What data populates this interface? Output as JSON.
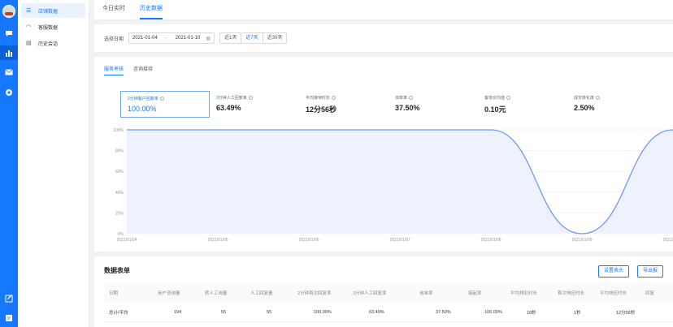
{
  "rail": {
    "items": [
      "avatar",
      "chat-icon",
      "chart-icon",
      "mail-icon",
      "settings-icon",
      "edit-icon",
      "note-icon"
    ]
  },
  "subnav": {
    "items": [
      {
        "label": "店铺数据",
        "icon": "list-icon"
      },
      {
        "label": "客服数据",
        "icon": "headset-icon"
      },
      {
        "label": "历史会话",
        "icon": "document-icon"
      }
    ],
    "active_index": 0
  },
  "top_tabs": [
    "今日实时",
    "历史数据"
  ],
  "active_top_tab": 1,
  "filter": {
    "label": "选择日期",
    "start": "2021-01-04",
    "separator": "-",
    "end": "2021-01-10",
    "quick": [
      "近1天",
      "近7天",
      "近30天"
    ],
    "active_quick": 1
  },
  "sub_tabs": [
    "服务考核",
    "咨询接待"
  ],
  "active_sub_tab": 0,
  "kpis": [
    {
      "label": "2分钟客户回复率",
      "value": "100.00%"
    },
    {
      "label": "3分钟人工回复率",
      "value": "63.49%"
    },
    {
      "label": "平均接待时长",
      "value": "12分56秒"
    },
    {
      "label": "询单率",
      "value": "37.50%"
    },
    {
      "label": "客单价均值",
      "value": "0.10元"
    },
    {
      "label": "成交转化率",
      "value": "2.50%"
    }
  ],
  "active_kpi": 0,
  "chart_data": {
    "type": "area",
    "x": [
      "2021/01/04",
      "2021/01/05",
      "2021/01/06",
      "2021/01/07",
      "2021/01/08",
      "2021/01/09",
      "2021/01/10"
    ],
    "series": [
      {
        "values": [
          100,
          100,
          100,
          100,
          100,
          0,
          100
        ]
      }
    ],
    "ytick_labels": [
      "0%",
      "20%",
      "40%",
      "60%",
      "80%",
      "100%"
    ],
    "ylim": [
      0,
      100
    ],
    "grid": true,
    "color": "#6d98f5",
    "fill": "#eef2fd"
  },
  "table": {
    "title": "数据表单",
    "buttons": [
      "设置表头",
      "导出报"
    ],
    "headers": [
      "日期",
      "用户咨询量",
      "转人工询量",
      "人工回复量",
      "2分钟首次回复率",
      "3分钟人工回复率",
      "询单率",
      "接起率",
      "平均排队时长",
      "首次响应时长",
      "平均响应时长",
      "回复"
    ],
    "rows": [
      [
        "总计/平均",
        "194",
        "55",
        "55",
        "100.00%",
        "63.49%",
        "37.50%",
        "100.00%",
        "18秒",
        "1秒",
        "12分56秒",
        ""
      ]
    ]
  }
}
